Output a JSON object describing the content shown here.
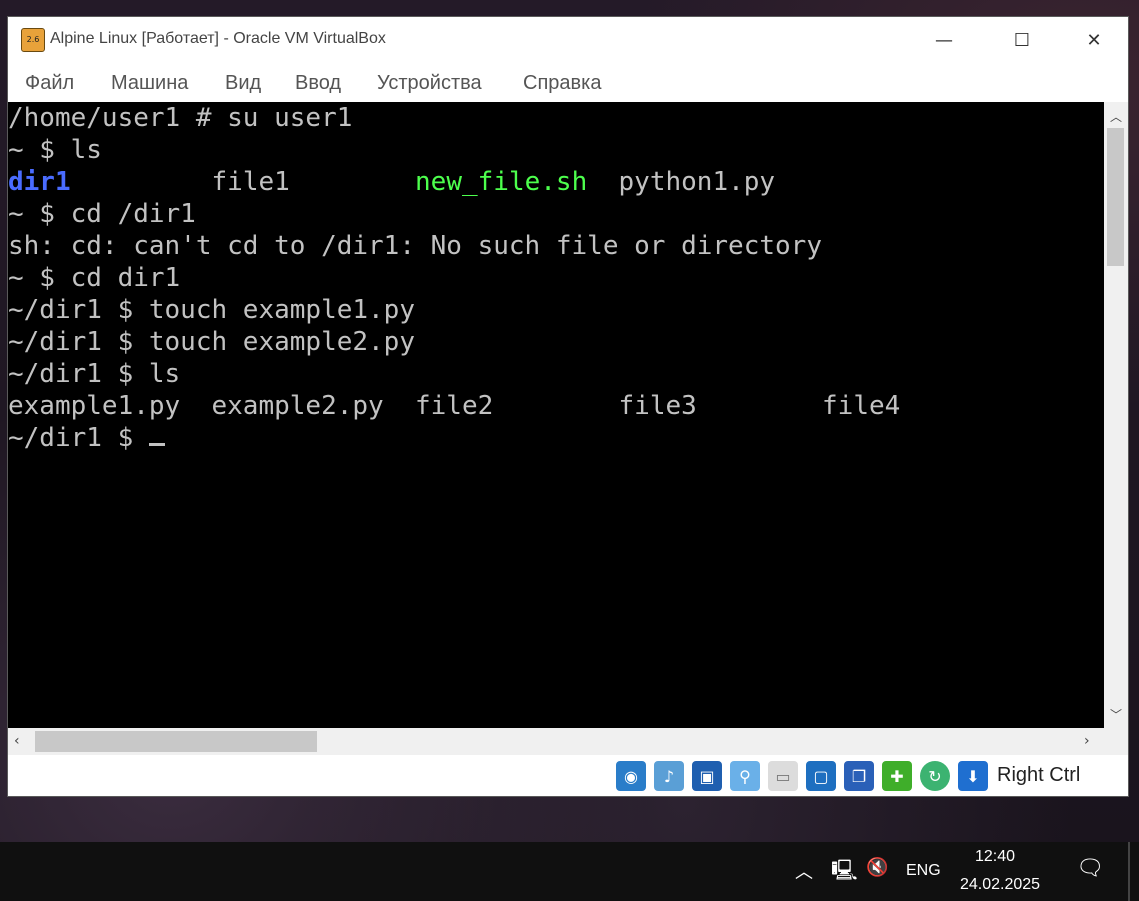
{
  "window": {
    "title": "Alpine Linux [Работает] - Oracle VM VirtualBox",
    "app_icon_label": "2.6",
    "controls": {
      "minimize": "—",
      "maximize": "☐",
      "close": "✕"
    }
  },
  "menu": [
    "Файл",
    "Машина",
    "Вид",
    "Ввод",
    "Устройства",
    "Справка"
  ],
  "terminal": {
    "lines": [
      "/home/user1 # su user1",
      "~ $ ls",
      {
        "type": "ls",
        "items": [
          {
            "text": "dir1",
            "kind": "dir",
            "pad": "         "
          },
          {
            "text": "file1",
            "kind": "file",
            "pad": "        "
          },
          {
            "text": "new_file.sh",
            "kind": "exec",
            "pad": "  "
          },
          {
            "text": "python1.py",
            "kind": "file",
            "pad": ""
          }
        ]
      },
      "~ $ cd /dir1",
      "sh: cd: can't cd to /dir1: No such file or directory",
      "~ $ cd dir1",
      "~/dir1 $ touch example1.py",
      "~/dir1 $ touch example2.py",
      "~/dir1 $ ls",
      {
        "type": "ls",
        "items": [
          {
            "text": "example1.py",
            "kind": "file",
            "pad": "  "
          },
          {
            "text": "example2.py",
            "kind": "file",
            "pad": "  "
          },
          {
            "text": "file2",
            "kind": "file",
            "pad": "        "
          },
          {
            "text": "file3",
            "kind": "file",
            "pad": "        "
          },
          {
            "text": "file4",
            "kind": "file",
            "pad": ""
          }
        ]
      },
      "~/dir1 $ "
    ],
    "colors": {
      "fg": "#c2c2c2",
      "dir": "#4a6cff",
      "exec": "#4dff4d",
      "bg": "#000000"
    }
  },
  "status_icons": [
    "hard-disk-icon",
    "audio-icon",
    "network-icon",
    "usb-icon",
    "shared-folder-icon",
    "display-icon",
    "video-capture-icon",
    "cpu-icon",
    "recording-icon",
    "mouse-integration-icon"
  ],
  "statusbar": {
    "host_key": "Right Ctrl"
  },
  "taskbar": {
    "language": "ENG",
    "time": "12:40",
    "date": "24.02.2025"
  }
}
